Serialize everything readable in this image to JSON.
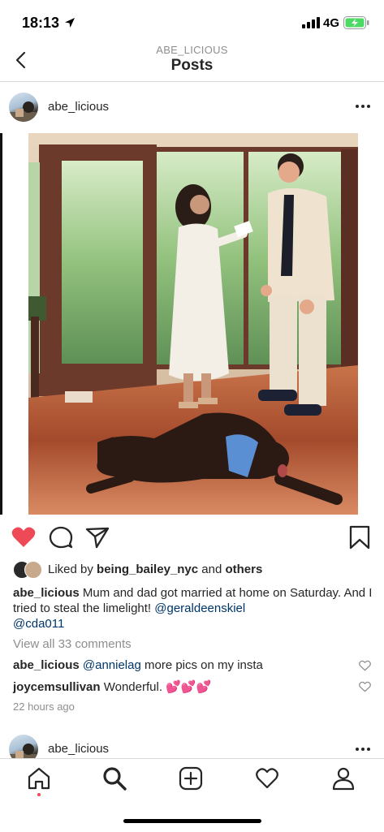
{
  "status": {
    "time": "18:13",
    "network": "4G"
  },
  "nav": {
    "subtitle": "ABE_LICIOUS",
    "title": "Posts"
  },
  "post": {
    "username": "abe_licious",
    "likes": {
      "prefix": "Liked by ",
      "user": "being_bailey_nyc",
      "middle": " and ",
      "others": "others"
    },
    "caption": {
      "username": "abe_licious",
      "text": " Mum and dad got married at home on Saturday. And I tried to steal the limelight!  ",
      "mention1": "@geraldeenskiel",
      "mention2": "@cda011"
    },
    "view_comments": "View all 33 comments",
    "comments": [
      {
        "user": "abe_licious",
        "mention": "@annielag",
        "text": " more pics on my insta"
      },
      {
        "user": "joycemsullivan",
        "text": " Wonderful. 💕💕💕"
      }
    ],
    "time_ago": "22 hours ago"
  },
  "next_post": {
    "username": "abe_licious"
  },
  "colors": {
    "like_red": "#ed4956",
    "mention_blue": "#003569",
    "muted": "#8e8e8e"
  },
  "icons": [
    "location-arrow-icon",
    "signal-icon",
    "battery-icon",
    "back-chevron-icon",
    "more-dots-icon",
    "heart-filled-icon",
    "comment-icon",
    "share-icon",
    "bookmark-icon",
    "heart-outline-icon",
    "home-icon",
    "search-icon",
    "add-icon",
    "activity-heart-icon",
    "profile-icon"
  ]
}
